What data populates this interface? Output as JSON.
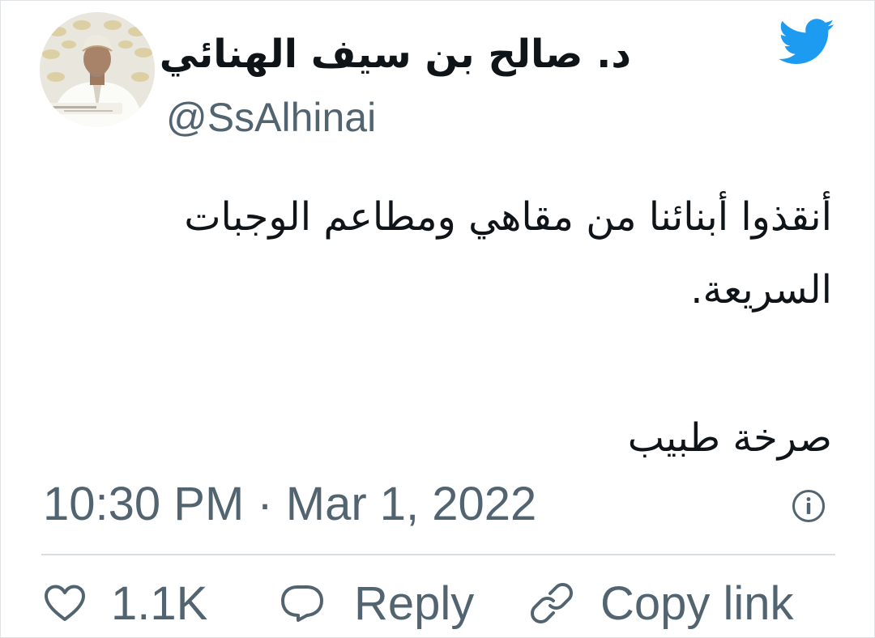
{
  "tweet": {
    "author": {
      "display_name": "د. صالح بن سيف الهنائي",
      "handle": "@SsAlhinai",
      "avatar_icon": "profile-photo"
    },
    "text_lines": [
      "أنقذوا أبنائنا من مقاهي ومطاعم الوجبات السريعة."
    ],
    "signoff": "صرخة طبيب",
    "timestamp": "10:30 PM · Mar 1, 2022",
    "actions": {
      "like_count": "1.1K",
      "reply_label": "Reply",
      "copy_link_label": "Copy link"
    }
  },
  "icons": {
    "brand": "twitter-bird-icon",
    "info": "info-icon",
    "like": "heart-icon",
    "reply": "speech-bubble-icon",
    "copy": "link-icon"
  },
  "colors": {
    "brand_blue": "#1d9bf0",
    "text_primary": "#0f1419",
    "text_secondary": "#536471",
    "divider": "#d8dde1"
  }
}
